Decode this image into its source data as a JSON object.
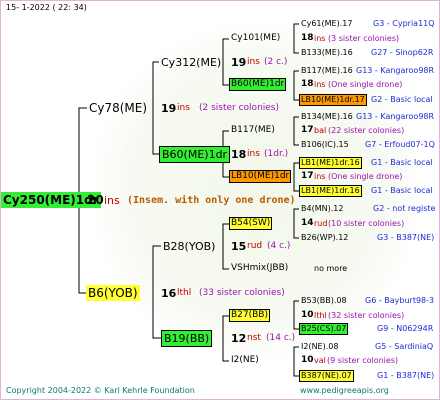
{
  "header": {
    "text": "15-   1-2022 (  22:  34)"
  },
  "footer": {
    "copyright": "Copyright 2004-2022 © Karl Kehrle Foundation",
    "site": "www.pedigreeapis.org"
  },
  "root": {
    "name": "Cy250(ME)1dr",
    "number": "20",
    "unit": "ins",
    "note": "(Insem. with only one drone)"
  },
  "g1": [
    {
      "name": "Cy78(ME)",
      "number": "19",
      "unit": "ins",
      "note": "(2 sister colonies)"
    },
    {
      "name": "B6(YOB)",
      "number": "16",
      "unit": "lthl",
      "note": "(33 sister colonies)"
    }
  ],
  "g2": [
    {
      "name": "Cy312(ME)",
      "number": "19",
      "unit": "ins",
      "note": "(2 c.)"
    },
    {
      "name": "B60(ME)1dr",
      "number": "18",
      "unit": "ins",
      "note": "(1dr.)"
    },
    {
      "name": "B28(YOB)",
      "number": "15",
      "unit": "rud",
      "note": "(4 c.)"
    },
    {
      "name": "B19(BB)",
      "number": "12",
      "unit": "nst",
      "note": "(14 c.)"
    }
  ],
  "g3": [
    {
      "name": "Cy101(ME)",
      "number": "18",
      "unit": "ins",
      "note": "(3 sister colonies)"
    },
    {
      "name": "B60(ME)1dr",
      "number": "18",
      "unit": "ins",
      "note": "(One single drone)"
    },
    {
      "name": "B117(ME)",
      "number": "17",
      "unit": "bal",
      "note": "(22 sister colonies)"
    },
    {
      "name": "LB10(ME)1dr",
      "number": "17",
      "unit": "ins",
      "note": "(One single drone)"
    },
    {
      "name": "B54(SW)",
      "number": "14",
      "unit": "rud",
      "note": "(10 sister colonies)"
    },
    {
      "name": "VSHmix(JBB)",
      "number": "",
      "unit": "",
      "note": "no more"
    },
    {
      "name": "B27(BB)",
      "number": "10",
      "unit": "lthl",
      "note": "(32 sister colonies)"
    },
    {
      "name": "I2(NE)",
      "number": "10",
      "unit": "val",
      "note": "(9 sister colonies)"
    }
  ],
  "g4": [
    {
      "name": "Cy61(ME).17",
      "code": "G3 - Cypria11Q"
    },
    {
      "name": "B133(ME).16",
      "code": "G27 - Sinop62R"
    },
    {
      "name": "B117(ME).16",
      "code": "G13 - Kangaroo98R"
    },
    {
      "name": "LB10(ME)1dr.17",
      "code": "G2 - Basic local"
    },
    {
      "name": "B134(ME).16",
      "code": "G13 - Kangaroo98R"
    },
    {
      "name": "B106(IC).15",
      "code": "G7 - Erfoud07-1Q"
    },
    {
      "name": "LB1(ME)1dr.16",
      "code": "G1 - Basic local"
    },
    {
      "name": "LB1(ME)1dr.16",
      "code": "G1 - Basic local"
    },
    {
      "name": "B4(MN).12",
      "code": "G2 - not registe"
    },
    {
      "name": "B26(WP).12",
      "code": "G3 - B387(NE)"
    },
    {
      "name": "B53(BB).08",
      "code": "G6 - Bayburt98-3"
    },
    {
      "name": "B25(CS).07",
      "code": "G9 - N06294R"
    },
    {
      "name": "I2(NE).08",
      "code": "G5 - SardiniaQ"
    },
    {
      "name": "B387(NE).07",
      "code": "G1 - B387(NE)"
    }
  ],
  "colors": {
    "green": "#33ee33",
    "yellow": "#ffff33",
    "orange": "#ff9900",
    "red": "#c00000",
    "purple": "#9a14b0",
    "blue": "#1f2ad8"
  }
}
